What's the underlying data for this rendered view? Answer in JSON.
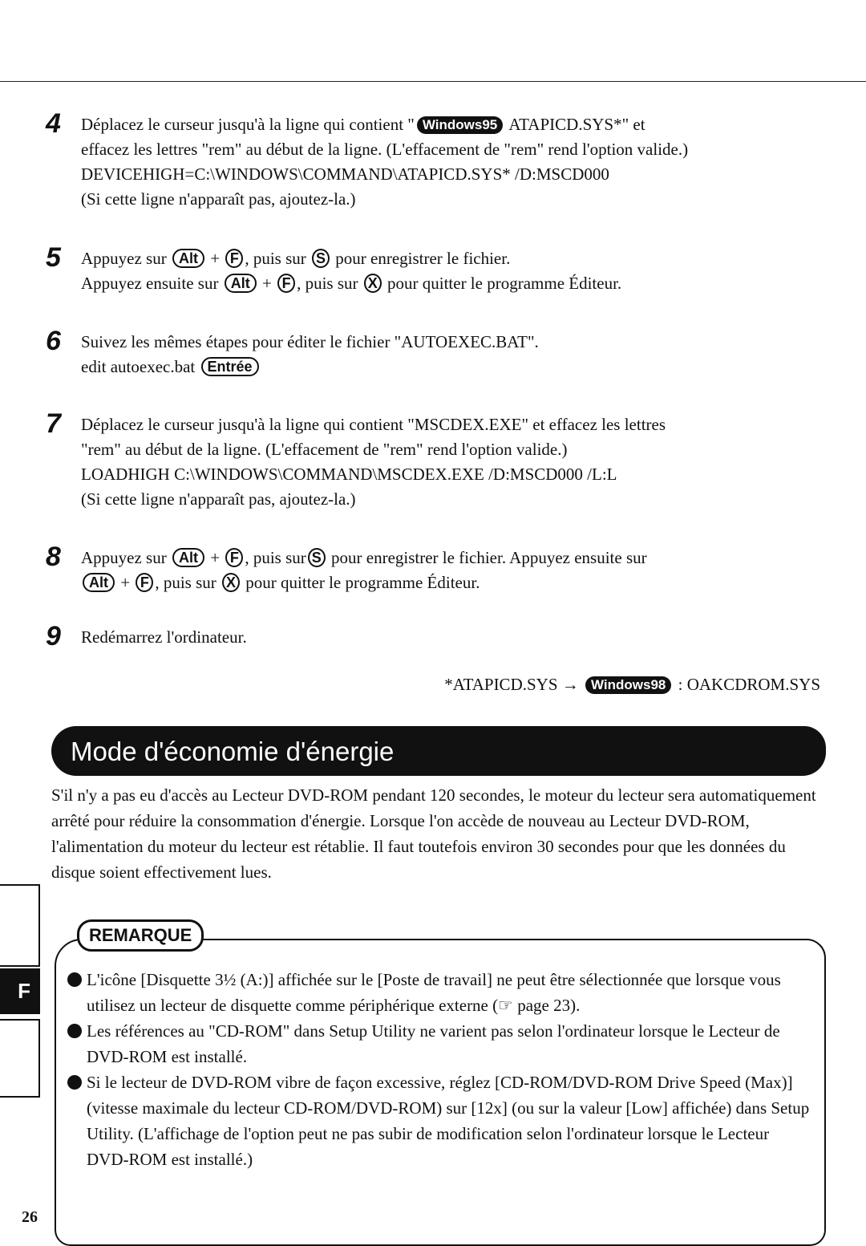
{
  "steps": {
    "s4": {
      "number": "4",
      "line1_a": "Déplacez le curseur jusqu'à la ligne qui contient \"",
      "badge": "Windows95",
      "line1_b": " ATAPICD.SYS*\" et",
      "line2": "effacez les lettres \"rem\" au début de la ligne. (L'effacement de \"rem\" rend l'option valide.)",
      "line3": "DEVICEHIGH=C:\\WINDOWS\\COMMAND\\ATAPICD.SYS* /D:MSCD000",
      "line4": "(Si cette ligne n'apparaît pas, ajoutez-la.)"
    },
    "s5": {
      "number": "5",
      "a1": "Appuyez sur ",
      "k_alt": "Alt",
      "plus": " + ",
      "k_f": "F",
      "a2": ", puis sur ",
      "k_s": "S",
      "a3": " pour enregistrer le fichier.",
      "b1": "Appuyez ensuite sur ",
      "b2": ", puis sur ",
      "k_x": "X",
      "b3": " pour quitter le programme Éditeur."
    },
    "s6": {
      "number": "6",
      "line1": "Suivez les mêmes étapes pour éditer le fichier \"AUTOEXEC.BAT\".",
      "line2": "edit autoexec.bat ",
      "k_enter": "Entrée"
    },
    "s7": {
      "number": "7",
      "line1": "Déplacez le curseur jusqu'à la ligne qui contient \"MSCDEX.EXE\" et effacez les lettres",
      "line2": "\"rem\" au début de la ligne. (L'effacement de \"rem\" rend l'option valide.)",
      "line3": "LOADHIGH  C:\\WINDOWS\\COMMAND\\MSCDEX.EXE /D:MSCD000 /L:L",
      "line4": "(Si cette ligne n'apparaît pas, ajoutez-la.)"
    },
    "s8": {
      "number": "8",
      "a1": "Appuyez sur ",
      "a2": ", puis sur",
      "a3": " pour enregistrer le fichier. Appuyez ensuite sur",
      "b2": ", puis sur ",
      "b3": " pour quitter le programme Éditeur."
    },
    "s9": {
      "number": "9",
      "line1": "Redémarrez l'ordinateur."
    }
  },
  "footnote": {
    "left": "*ATAPICD.SYS  →",
    "badge": "Windows98",
    "right": " : OAKCDROM.SYS"
  },
  "section": {
    "title": "Mode d'économie d'énergie",
    "paragraph": "S'il n'y a pas eu d'accès au Lecteur DVD-ROM pendant 120 secondes, le moteur du lecteur sera automatiquement arrêté pour réduire la consommation d'énergie. Lorsque l'on accède de nouveau au Lecteur DVD-ROM, l'alimentation du moteur du lecteur est rétablie. Il faut toutefois environ 30 secondes pour que les données du disque soient effectivement lues."
  },
  "remark": {
    "label": "REMARQUE",
    "items": [
      {
        "a": "L'icône [Disquette 3½ (A:)] affichée sur le [Poste de travail] ne peut être sélectionnée que lorsque vous utilisez un lecteur de disquette comme périphérique externe (",
        "ref_icon": "☞",
        "b": " page 23)."
      },
      {
        "a": "Les références au \"CD-ROM\" dans Setup Utility ne varient pas selon l'ordinateur lorsque le Lecteur de DVD-ROM est installé."
      },
      {
        "a": "Si le lecteur de DVD-ROM vibre de façon excessive, réglez [CD-ROM/DVD-ROM Drive Speed (Max)] (vitesse maximale du lecteur CD-ROM/DVD-ROM) sur [12x] (ou sur la valeur [Low] affichée) dans Setup Utility. (L'affichage de l'option peut ne pas subir de modification selon l'ordinateur lorsque le Lecteur DVD-ROM est installé.)"
      }
    ]
  },
  "side_tab": "F",
  "page_number": "26"
}
